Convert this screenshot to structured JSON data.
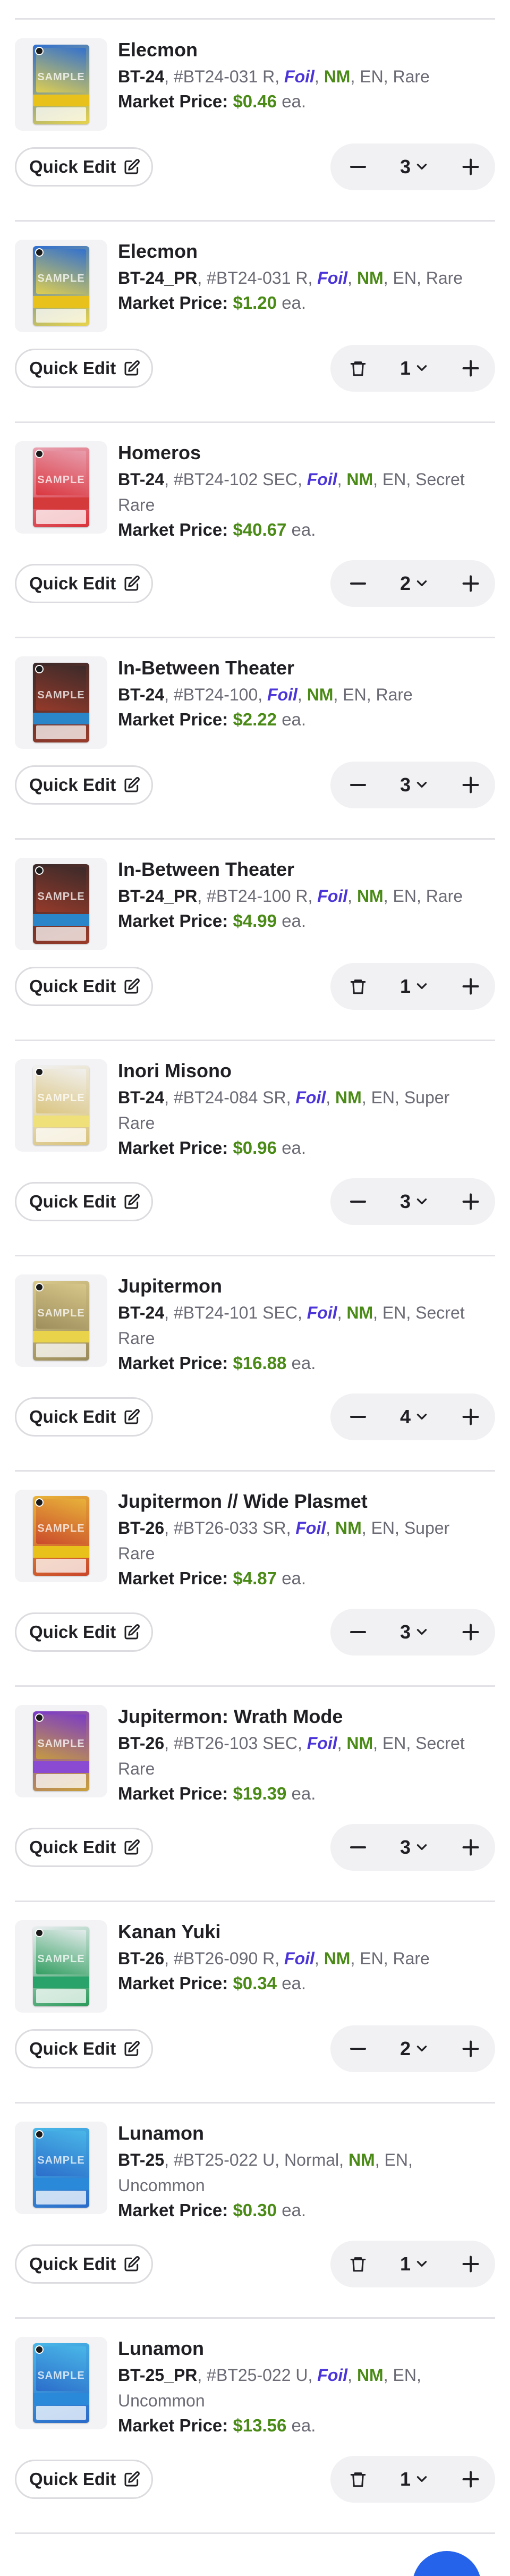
{
  "labels": {
    "market_price": "Market Price:",
    "each": "ea.",
    "quick_edit": "Quick Edit"
  },
  "items": [
    {
      "name": "Elecmon",
      "set": "BT-24",
      "number": "#BT24-031 R",
      "printing": "Foil",
      "condition": "NM",
      "language": "EN",
      "rarity": "Rare",
      "price": "$0.46",
      "qty": "3",
      "qty_action": "minus",
      "card_colors": [
        "#2f6fd1",
        "#e8d34a"
      ],
      "band_color": "#e8c21a"
    },
    {
      "name": "Elecmon",
      "set": "BT-24_PR",
      "number": "#BT24-031 R",
      "printing": "Foil",
      "condition": "NM",
      "language": "EN",
      "rarity": "Rare",
      "price": "$1.20",
      "qty": "1",
      "qty_action": "trash",
      "card_colors": [
        "#2f6fd1",
        "#e8d34a"
      ],
      "band_color": "#e8c21a"
    },
    {
      "name": "Homeros",
      "set": "BT-24",
      "number": "#BT24-102 SEC",
      "printing": "Foil",
      "condition": "NM",
      "language": "EN",
      "rarity": "Secret Rare",
      "price": "$40.67",
      "qty": "2",
      "qty_action": "minus",
      "card_colors": [
        "#e8a0b0",
        "#d9323a"
      ],
      "band_color": "#d43a3a"
    },
    {
      "name": "In-Between Theater",
      "set": "BT-24",
      "number": "#BT24-100",
      "printing": "Foil",
      "condition": "NM",
      "language": "EN",
      "rarity": "Rare",
      "price": "$2.22",
      "qty": "3",
      "qty_action": "minus",
      "card_colors": [
        "#3a2a2a",
        "#9a3b2a"
      ],
      "band_color": "#2a86c9"
    },
    {
      "name": "In-Between Theater",
      "set": "BT-24_PR",
      "number": "#BT24-100 R",
      "printing": "Foil",
      "condition": "NM",
      "language": "EN",
      "rarity": "Rare",
      "price": "$4.99",
      "qty": "1",
      "qty_action": "trash",
      "card_colors": [
        "#3a2a2a",
        "#9a3b2a"
      ],
      "band_color": "#2a86c9"
    },
    {
      "name": "Inori Misono",
      "set": "BT-24",
      "number": "#BT24-084 SR",
      "printing": "Foil",
      "condition": "NM",
      "language": "EN",
      "rarity": "Super Rare",
      "price": "$0.96",
      "qty": "3",
      "qty_action": "minus",
      "card_colors": [
        "#f1f1f1",
        "#d9c27a"
      ],
      "band_color": "#efe07a"
    },
    {
      "name": "Jupitermon",
      "set": "BT-24",
      "number": "#BT24-101 SEC",
      "printing": "Foil",
      "condition": "NM",
      "language": "EN",
      "rarity": "Secret Rare",
      "price": "$16.88",
      "qty": "4",
      "qty_action": "minus",
      "card_colors": [
        "#d9c88a",
        "#9a8b5a"
      ],
      "band_color": "#e8d34a"
    },
    {
      "name": "Jupitermon // Wide Plasmet",
      "set": "BT-26",
      "number": "#BT26-033 SR",
      "printing": "Foil",
      "condition": "NM",
      "language": "EN",
      "rarity": "Super Rare",
      "price": "$4.87",
      "qty": "3",
      "qty_action": "minus",
      "card_colors": [
        "#e8b43a",
        "#c9452a"
      ],
      "band_color": "#e8c21a"
    },
    {
      "name": "Jupitermon: Wrath Mode",
      "set": "BT-26",
      "number": "#BT26-103 SEC",
      "printing": "Foil",
      "condition": "NM",
      "language": "EN",
      "rarity": "Secret Rare",
      "price": "$19.39",
      "qty": "3",
      "qty_action": "minus",
      "card_colors": [
        "#7a3ac9",
        "#c9a03a"
      ],
      "band_color": "#8a4ad1"
    },
    {
      "name": "Kanan Yuki",
      "set": "BT-26",
      "number": "#BT26-090 R",
      "printing": "Foil",
      "condition": "NM",
      "language": "EN",
      "rarity": "Rare",
      "price": "$0.34",
      "qty": "2",
      "qty_action": "minus",
      "card_colors": [
        "#e9eef0",
        "#2a9a5a"
      ],
      "band_color": "#2aa36a"
    },
    {
      "name": "Lunamon",
      "set": "BT-25",
      "number": "#BT25-022 U",
      "printing": "Normal",
      "condition": "NM",
      "language": "EN",
      "rarity": "Uncommon",
      "price": "$0.30",
      "qty": "1",
      "qty_action": "trash",
      "card_colors": [
        "#4ab8e8",
        "#2a6ac9"
      ],
      "band_color": "#2a8ad9"
    },
    {
      "name": "Lunamon",
      "set": "BT-25_PR",
      "number": "#BT25-022 U",
      "printing": "Foil",
      "condition": "NM",
      "language": "EN",
      "rarity": "Uncommon",
      "price": "$13.56",
      "qty": "1",
      "qty_action": "trash",
      "card_colors": [
        "#4ab8e8",
        "#2a6ac9"
      ],
      "band_color": "#2a8ad9"
    }
  ]
}
